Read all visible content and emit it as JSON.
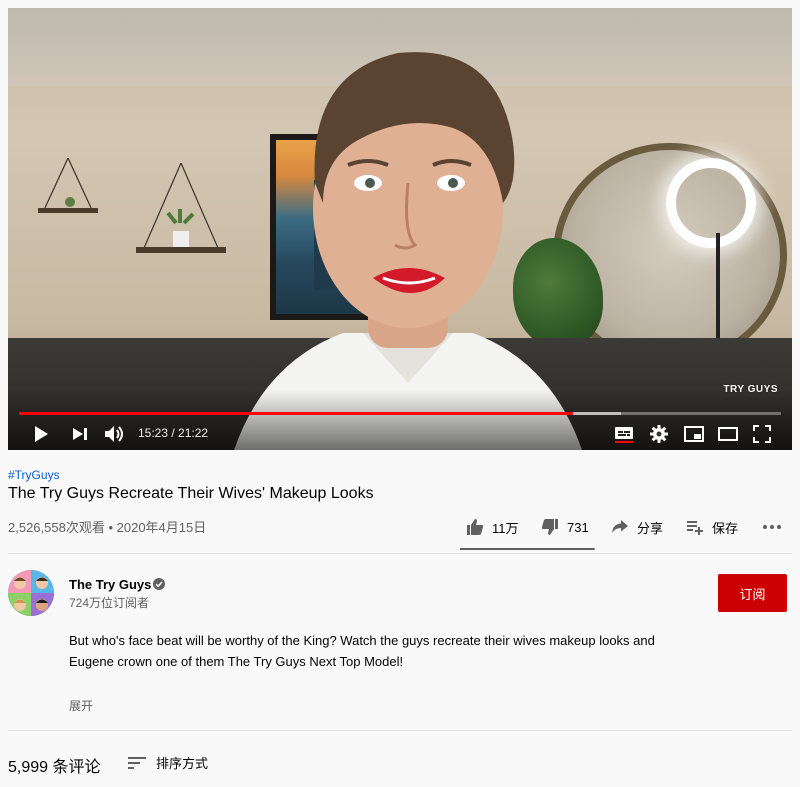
{
  "player": {
    "progress_fraction": 0.7269,
    "buffered_fraction": 0.79,
    "current_time": "15:23",
    "total_time": "21:22",
    "time_separator": " / ",
    "watermark": "TRY GUYS",
    "controls": {
      "play_icon": "play-icon",
      "next_icon": "skip-next-icon",
      "volume_icon": "volume-icon",
      "subtitles_icon": "subtitles-icon",
      "settings_icon": "gear-icon",
      "miniplayer_icon": "miniplayer-icon",
      "theater_icon": "theater-mode-icon",
      "fullscreen_icon": "fullscreen-icon"
    },
    "accent_color": "#ff0000"
  },
  "video": {
    "hashtag": "#TryGuys",
    "title": "The Try Guys Recreate Their Wives' Makeup Looks",
    "views": "2,526,558次观看",
    "separator": " • ",
    "date": "2020年4月15日"
  },
  "actions": {
    "like_count": "11万",
    "dislike_count": "731",
    "share_label": "分享",
    "save_label": "保存",
    "more_icon": "more-icon",
    "like_ratio": 0.99
  },
  "channel": {
    "name": "The Try Guys",
    "subscribers": "724万位订阅者",
    "subscribe_label": "订阅",
    "subscribe_color": "#cc0000",
    "verified_icon": "verified-icon"
  },
  "description": {
    "text": "But who's face beat will be worthy of the King? Watch the guys recreate their wives makeup looks and Eugene crown one of them The Try Guys Next Top Model!",
    "expand_label": "展开"
  },
  "comments": {
    "count_label": "5,999 条评论",
    "sort_label": "排序方式"
  }
}
